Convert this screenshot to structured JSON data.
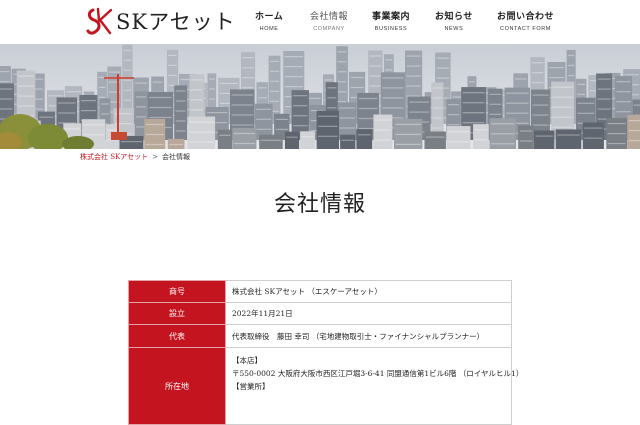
{
  "header": {
    "logo_text": "SKアセット",
    "nav": [
      {
        "label": "ホーム",
        "sub": "HOME",
        "active": false
      },
      {
        "label": "会社情報",
        "sub": "COMPANY",
        "active": true
      },
      {
        "label": "事業案内",
        "sub": "BUSINESS",
        "active": false
      },
      {
        "label": "お知らせ",
        "sub": "NEWS",
        "active": false
      },
      {
        "label": "お問い合わせ",
        "sub": "CONTACT FORM",
        "active": false
      }
    ]
  },
  "breadcrumb": {
    "home": "株式会社 SKアセット",
    "separator": ">",
    "current": "会社情報"
  },
  "page_title": "会社情報",
  "company_table": {
    "rows": [
      {
        "label": "商号",
        "value": "株式会社 SKアセット （エスケーアセット）"
      },
      {
        "label": "設立",
        "value": "2022年11月21日"
      },
      {
        "label": "代表",
        "value": "代表取締役　藤田 幸司 （宅地建物取引士・ファイナンシャルプランナー）"
      }
    ],
    "address": {
      "label": "所在地",
      "head_office_title": "【本店】",
      "head_office": "〒550-0002 大阪府大阪市西区江戸堀3-6-41 同盟通信第1ビル6階 （ロイヤルヒル1）",
      "sales_office_title": "【営業所】"
    }
  },
  "colors": {
    "brand": "#c4141f",
    "text": "#222222",
    "border": "#cfcfcf"
  }
}
